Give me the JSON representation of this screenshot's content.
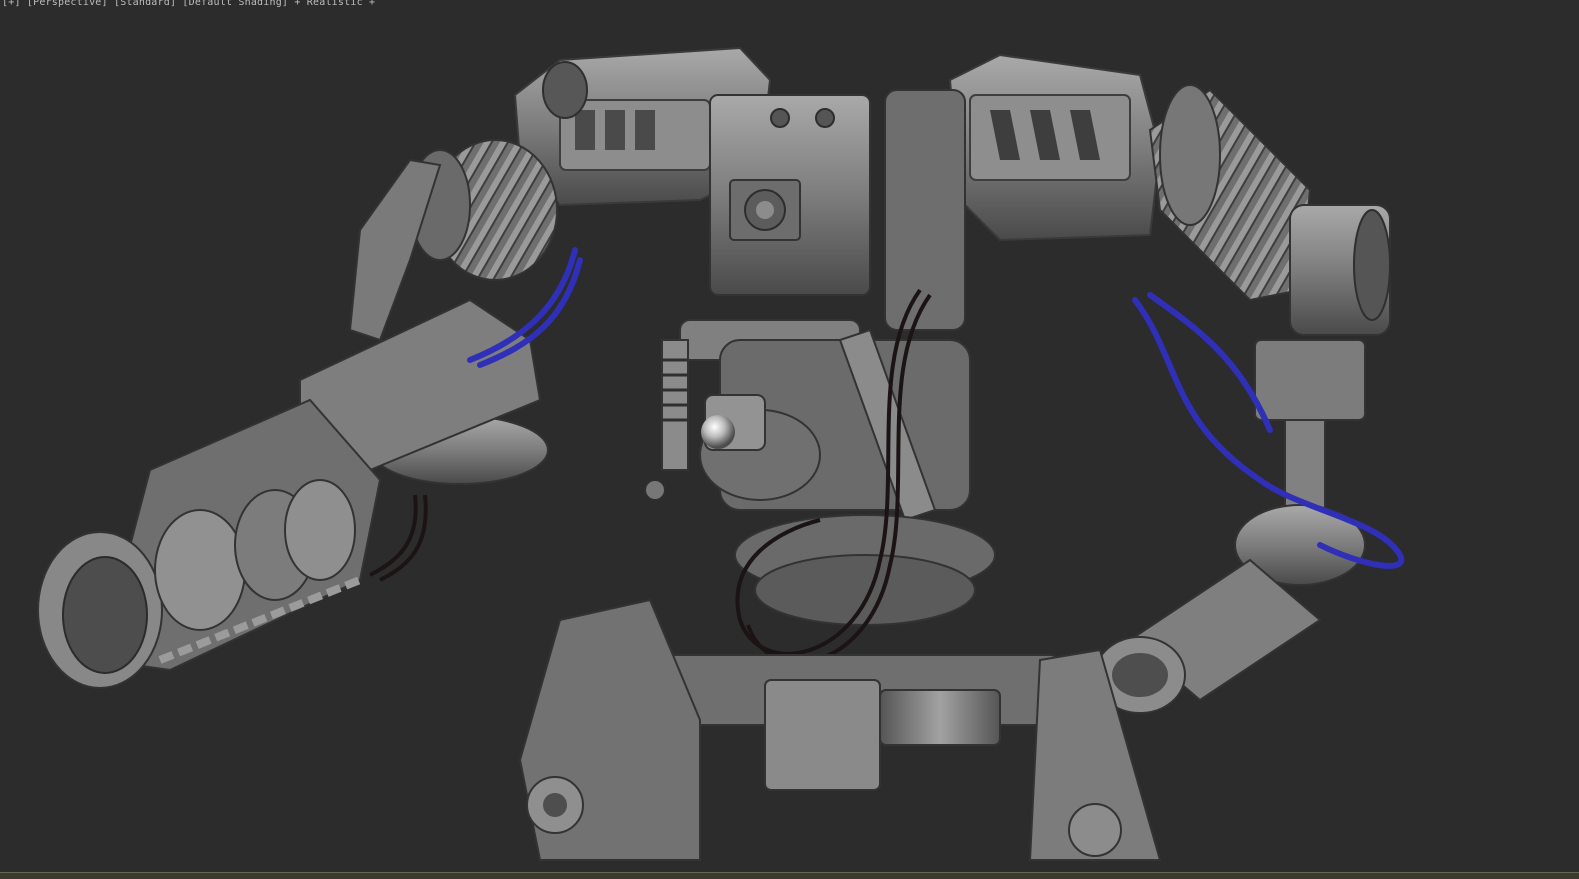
{
  "viewport": {
    "label": "[+] [Perspective] [Standard] [Default Shading] + Realistic +",
    "background_color": "#2c2c2c"
  },
  "model": {
    "description_icon": "mech-robot-3d-model",
    "cable_color_blue": "#2f2fb8",
    "cable_color_dark": "#1a1212",
    "metal_color": "#8a8a8a"
  }
}
